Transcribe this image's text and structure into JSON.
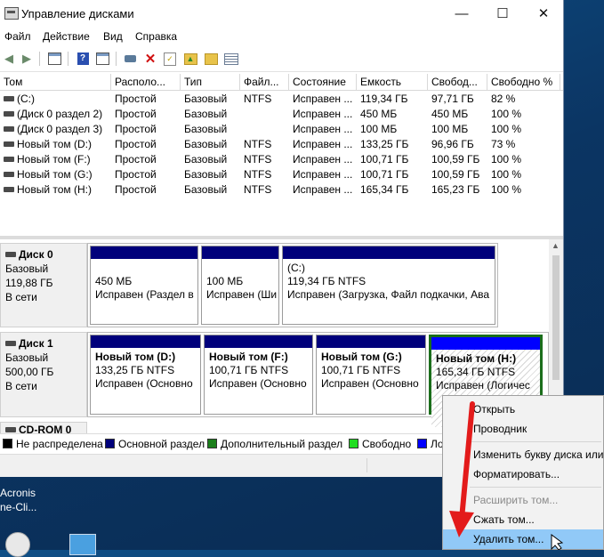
{
  "window": {
    "title": "Управление дисками"
  },
  "titlebar": {
    "minimize": "—",
    "maximize": "☐",
    "close": "✕"
  },
  "menu": [
    "Файл",
    "Действие",
    "Вид",
    "Справка"
  ],
  "volume_table": {
    "columns": [
      "Том",
      "Располо...",
      "Тип",
      "Файл...",
      "Состояние",
      "Емкость",
      "Свобод...",
      "Свободно %"
    ],
    "rows": [
      [
        "(C:)",
        "Простой",
        "Базовый",
        "NTFS",
        "Исправен ...",
        "119,34 ГБ",
        "97,71 ГБ",
        "82 %"
      ],
      [
        "(Диск 0 раздел 2)",
        "Простой",
        "Базовый",
        "",
        "Исправен ...",
        "450 МБ",
        "450 МБ",
        "100 %"
      ],
      [
        "(Диск 0 раздел 3)",
        "Простой",
        "Базовый",
        "",
        "Исправен ...",
        "100 МБ",
        "100 МБ",
        "100 %"
      ],
      [
        "Новый том (D:)",
        "Простой",
        "Базовый",
        "NTFS",
        "Исправен ...",
        "133,25 ГБ",
        "96,96 ГБ",
        "73 %"
      ],
      [
        "Новый том (F:)",
        "Простой",
        "Базовый",
        "NTFS",
        "Исправен ...",
        "100,71 ГБ",
        "100,59 ГБ",
        "100 %"
      ],
      [
        "Новый том (G:)",
        "Простой",
        "Базовый",
        "NTFS",
        "Исправен ...",
        "100,71 ГБ",
        "100,59 ГБ",
        "100 %"
      ],
      [
        "Новый том (H:)",
        "Простой",
        "Базовый",
        "NTFS",
        "Исправен ...",
        "165,34 ГБ",
        "165,23 ГБ",
        "100 %"
      ]
    ]
  },
  "disks": {
    "disk0": {
      "name": "Диск 0",
      "type": "Базовый",
      "size": "119,88 ГБ",
      "status": "В сети",
      "partitions": [
        {
          "title": "",
          "size": "450 МБ",
          "status": "Исправен (Раздел в"
        },
        {
          "title": "",
          "size": "100 МБ",
          "status": "Исправен (Ши"
        },
        {
          "title": "(C:)",
          "size": "119,34 ГБ NTFS",
          "status": "Исправен (Загрузка, Файл подкачки, Ава"
        }
      ]
    },
    "disk1": {
      "name": "Диск 1",
      "type": "Базовый",
      "size": "500,00 ГБ",
      "status": "В сети",
      "partitions": [
        {
          "title": "Новый том  (D:)",
          "size": "133,25 ГБ NTFS",
          "status": "Исправен (Основно"
        },
        {
          "title": "Новый том  (F:)",
          "size": "100,71 ГБ NTFS",
          "status": "Исправен (Основно"
        },
        {
          "title": "Новый том  (G:)",
          "size": "100,71 ГБ NTFS",
          "status": "Исправен (Основно"
        },
        {
          "title": "Новый том  (H:)",
          "size": "165,34 ГБ NTFS",
          "status": "Исправен (Логичес"
        }
      ]
    },
    "cdrom": {
      "name": "CD-ROM 0"
    }
  },
  "legend": [
    {
      "label": "Не распределена",
      "color": "#000000"
    },
    {
      "label": "Основной раздел",
      "color": "#00007b"
    },
    {
      "label": "Дополнительный раздел",
      "color": "#1b7f1b"
    },
    {
      "label": "Свободно",
      "color": "#22dd22"
    },
    {
      "label": "Ло",
      "color": "#0000ff"
    }
  ],
  "context_menu": {
    "items": [
      {
        "label": "Открыть",
        "enabled": true
      },
      {
        "label": "Проводник",
        "enabled": true
      },
      {
        "label": "Изменить букву диска или",
        "enabled": true
      },
      {
        "label": "Форматировать...",
        "enabled": true
      },
      {
        "label": "Расширить том...",
        "enabled": false
      },
      {
        "label": "Сжать том...",
        "enabled": true
      },
      {
        "label": "Удалить том...",
        "enabled": true,
        "highlighted": true
      }
    ]
  },
  "desktop": {
    "text1": "Acronis",
    "text2": "ne-Cli..."
  },
  "colors": {
    "arrow": "#e31b1b",
    "selection": "#91c9f7"
  }
}
